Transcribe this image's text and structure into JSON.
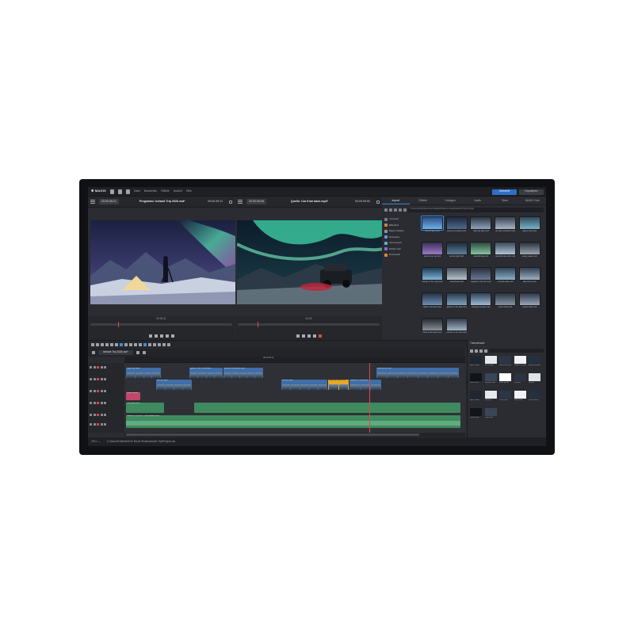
{
  "menubar": {
    "logo": "✱ MAGIX",
    "menus": [
      "Datei",
      "Bearbeiten",
      "Effekte",
      "Ansicht",
      "Hilfe"
    ],
    "right_buttons": [
      "Übersicht",
      "Exportieren"
    ]
  },
  "left_monitor": {
    "timecode_in": "00:00:45:21",
    "title": "Programm: Iceland Trip 2026.vsd*",
    "timecode_out": "00:00:39:11",
    "position": "00:03:11"
  },
  "right_monitor": {
    "timecode_in": "00:00:05:08",
    "title": "Quelle: Car from back.mp4*",
    "timecode_out": "00:00:09:00",
    "position": "00:00"
  },
  "media_pool": {
    "tabs": [
      "Import",
      "Effekte",
      "Vorlagen",
      "Audio",
      "Store",
      "MAGIX Hub"
    ],
    "active_tab": "Import",
    "path": "C:\\Users\\Public\\Documents\\MAGIX\\Movie Studio\\Iceland Trip\\Footage",
    "folders": [
      "Computer",
      "Bibliothek",
      "Eigene Medien",
      "Netzwerke",
      "Cloud Import",
      "MAGIX Hub",
      "Downloads"
    ],
    "items": [
      {
        "label": "aurora night.mp4"
      },
      {
        "label": "aurora mountains.mp4"
      },
      {
        "label": "night sky lake.mp4"
      },
      {
        "label": "car ride mountains.mp4"
      },
      {
        "label": "glacier river.mp4"
      },
      {
        "label": "aurora over car.mp4"
      },
      {
        "label": "tent at night.mp4"
      },
      {
        "label": "waterfall day.mp4"
      },
      {
        "label": "waterfall wide shot.mp4"
      },
      {
        "label": "snowy peaks.mp4"
      },
      {
        "label": "camper in the snow.mp4"
      },
      {
        "label": "road ahead.mp4"
      },
      {
        "label": "together in the tent.mp4"
      },
      {
        "label": "mountain lake.mp4"
      },
      {
        "label": "lake shore.mp4"
      },
      {
        "label": "lights in the field.mp4"
      },
      {
        "label": "glacier on the lake.mp4"
      },
      {
        "label": "icebergs at dawn.mp4"
      },
      {
        "label": "arctic cloud.mp4"
      },
      {
        "label": "vehicle dash.mp4"
      },
      {
        "label": "black sand beach.mp4"
      },
      {
        "label": "person on the rock.mp4"
      }
    ]
  },
  "timeline": {
    "tab": "Iceland Trip 2026.vsd*",
    "ruler_marker": "00:00:55:11",
    "clips": [
      {
        "title": "Night sky lake"
      },
      {
        "title": "glacier river mountains"
      },
      {
        "title": "aurora mountains.mp4"
      },
      {
        "title": "Aurora over car"
      },
      {
        "title": "tent at night"
      },
      {
        "title": "aurora night"
      },
      {
        "title": "waterfall wide shot"
      },
      {
        "title": "camper in the snow"
      },
      {
        "title": "Road ahead"
      },
      {
        "title": "mountain lake"
      }
    ],
    "audio_title": "Iceland Trip 2026 - Soundtrack.mp3"
  },
  "storyboard": {
    "title": "Trimmfenster",
    "items": [
      {
        "label": "Aurora night"
      },
      {
        "label": "tent at night"
      },
      {
        "label": "Aurora over car"
      },
      {
        "label": "camper in snow"
      },
      {
        "label": "aurora mountains"
      },
      {
        "label": "Black sand"
      },
      {
        "label": "Mountain lake"
      },
      {
        "label": "Road ahead"
      },
      {
        "label": "Waterfall"
      },
      {
        "label": "Glacier"
      },
      {
        "label": "Arctic cloud"
      },
      {
        "label": "Icebergs"
      },
      {
        "label": "Lake shore"
      },
      {
        "label": "Black sand"
      },
      {
        "label": "Vehicle dash"
      },
      {
        "label": "Person rock"
      },
      {
        "label": "Lights field"
      }
    ]
  },
  "status": {
    "cpu": "CPU: —",
    "file_path": "C:\\Users\\Public\\MAGIX Movie Studio\\Iceland Trip\\Project.vsd"
  }
}
